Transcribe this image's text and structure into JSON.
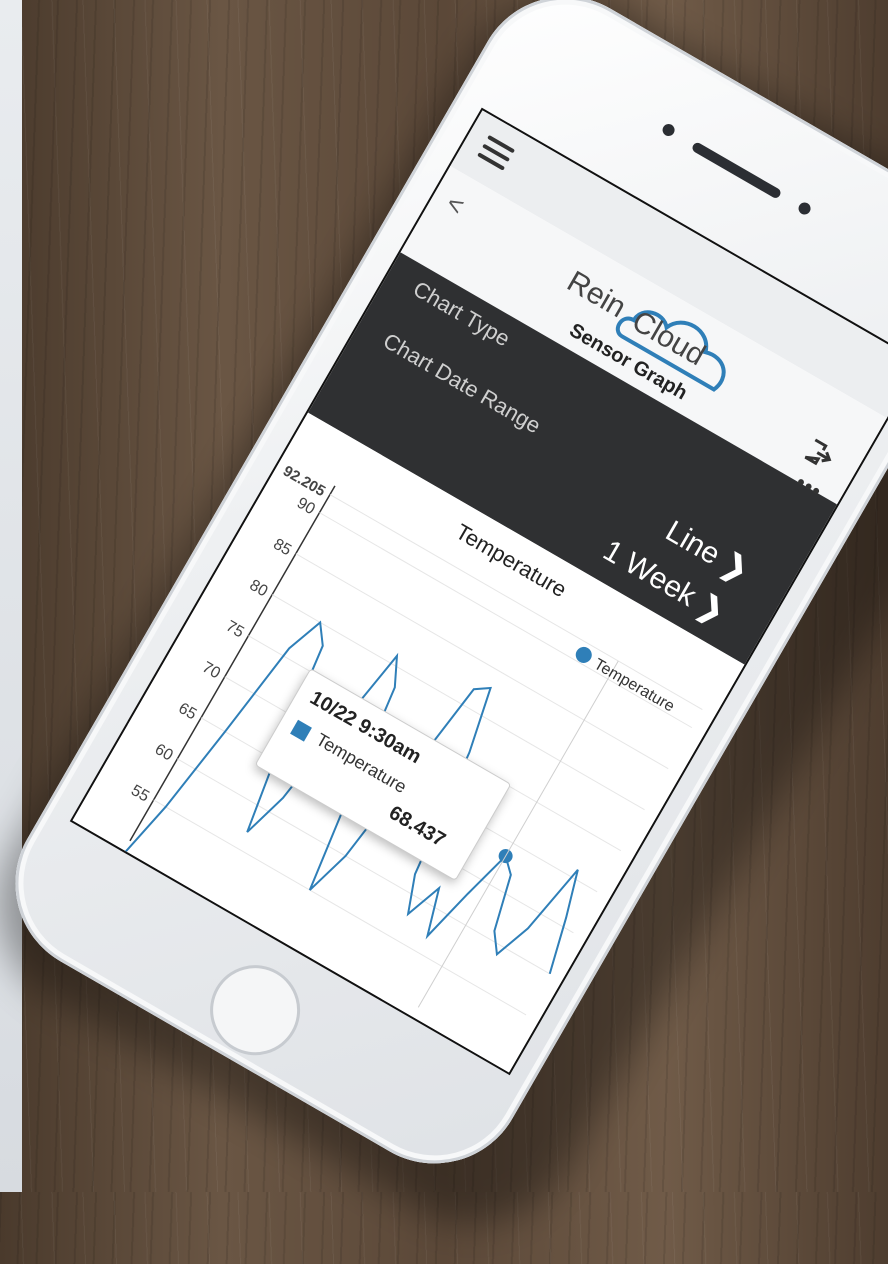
{
  "app": {
    "brand_left": "Rein",
    "brand_right": "Cloud",
    "page_title": "Sensor Graph"
  },
  "settings": {
    "chart_type_label": "Chart Type",
    "chart_type_value": "Line",
    "date_range_label": "Chart Date Range",
    "date_range_value": "1 Week",
    "chevron": "❯"
  },
  "icons": {
    "menu": "menu-icon",
    "back": "back-icon",
    "logout": "logout-icon",
    "more": "more-icon",
    "back_glyph": "<",
    "more_glyph": "•••"
  },
  "colors": {
    "series": "#2f7fb8",
    "settings_bg": "#2f3032"
  },
  "tooltip": {
    "date": "10/22 9:30am",
    "series_name": "Temperature",
    "value": "68.437"
  },
  "chart_data": {
    "type": "line",
    "title": "Temperature",
    "legend": "top-right",
    "ylim": [
      50,
      92.205
    ],
    "y_ticks": [
      "92.205",
      "90",
      "85",
      "80",
      "75",
      "70",
      "65",
      "60",
      "55"
    ],
    "series": [
      {
        "name": "Temperature",
        "values": [
          48,
          55,
          65,
          76,
          80,
          78,
          66,
          57,
          62,
          72,
          81,
          78,
          66,
          55,
          60,
          71,
          82,
          83,
          76,
          62,
          58,
          62,
          57,
          63,
          68.437,
          67,
          61,
          59,
          63,
          71,
          66,
          60
        ]
      }
    ]
  }
}
